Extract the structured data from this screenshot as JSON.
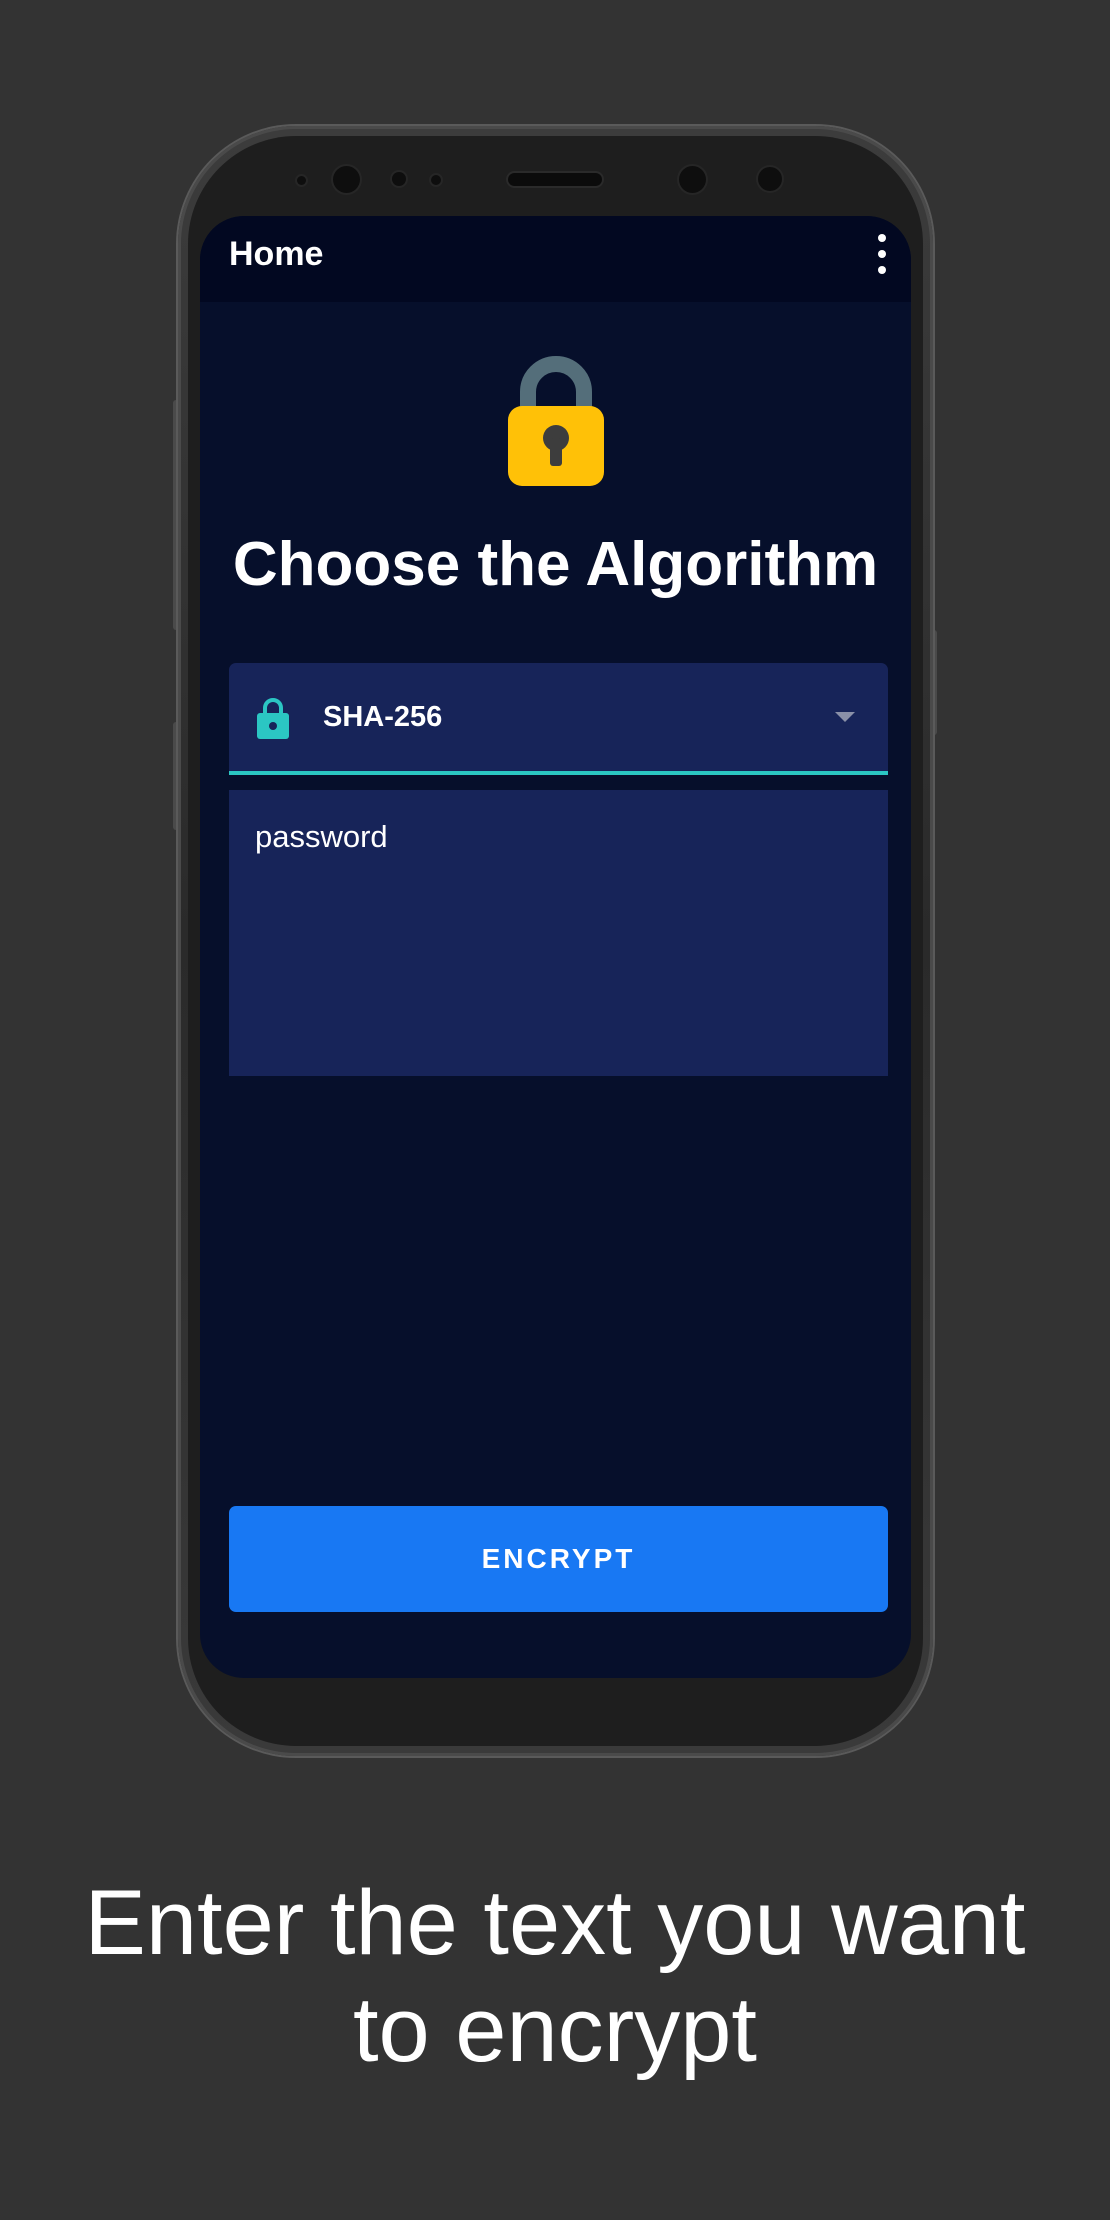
{
  "appbar": {
    "title": "Home",
    "menu_icon": "more-vert-icon"
  },
  "hero": {
    "icon": "padlock-icon",
    "heading": "Choose the Algorithm"
  },
  "algorithm_select": {
    "icon": "lock-icon",
    "selected": "SHA-256",
    "caret_icon": "arrow-drop-down-icon"
  },
  "input": {
    "value": "password"
  },
  "actions": {
    "encrypt_label": "ENCRYPT"
  },
  "caption": {
    "line1": "Enter the text you want",
    "line2": "to encrypt"
  },
  "colors": {
    "background": "#333333",
    "screen": "#060f2b",
    "appbar": "#020821",
    "field": "#172459",
    "accent": "#2bc6c3",
    "button": "#1878f3",
    "lock_body": "#ffc107",
    "lock_shackle": "#546e7a"
  }
}
